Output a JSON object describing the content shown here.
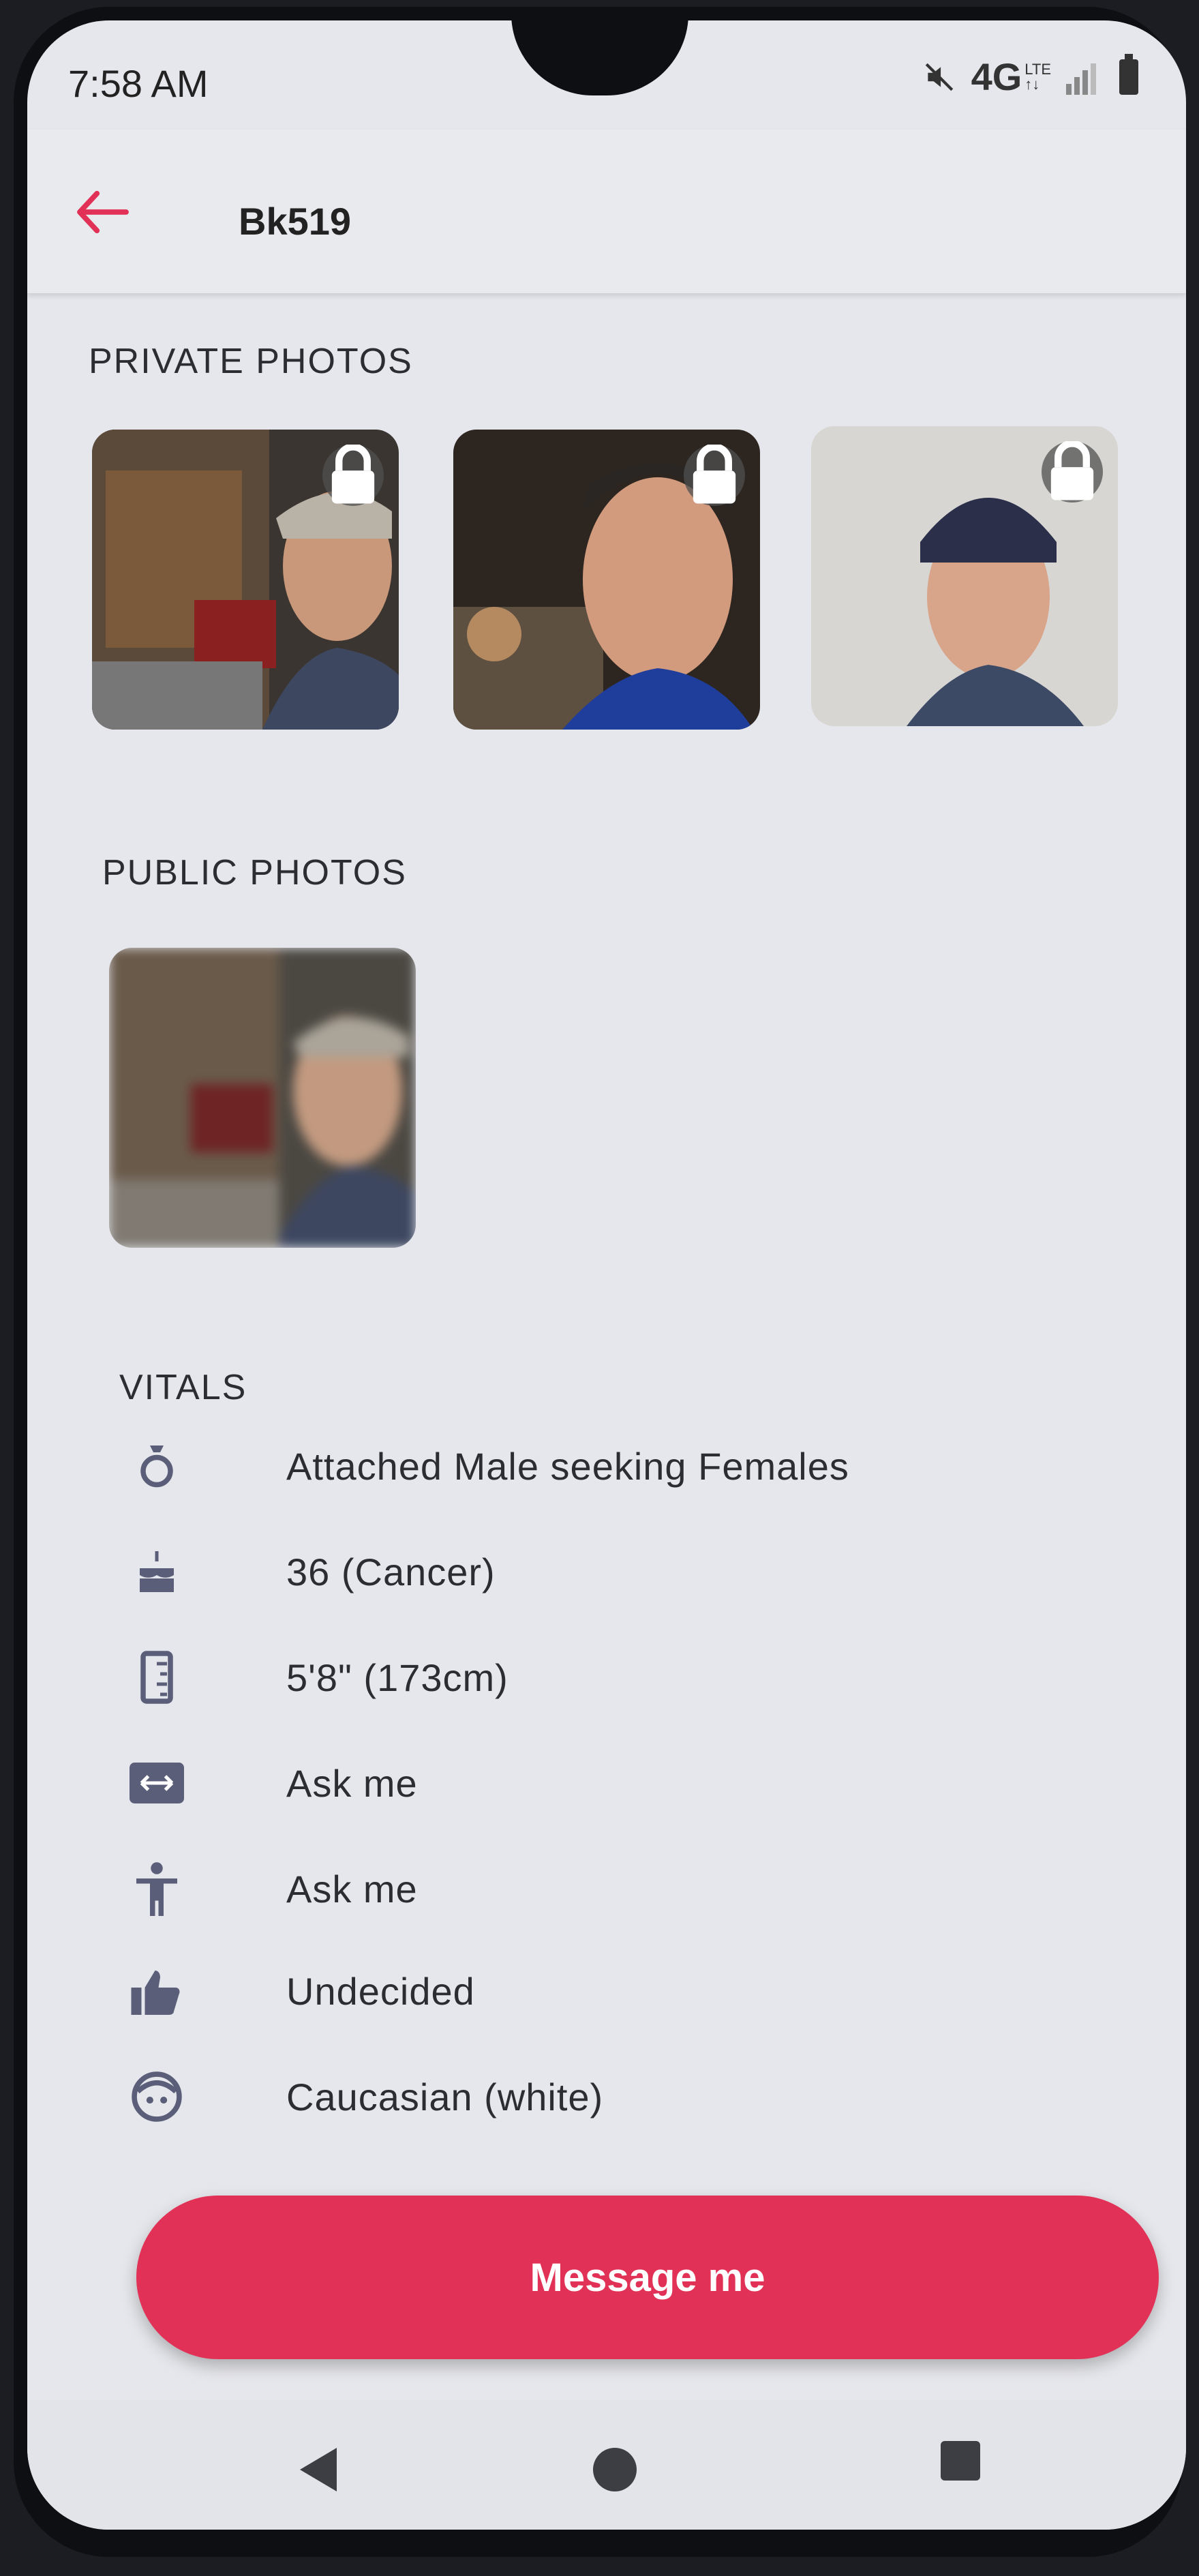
{
  "status": {
    "time": "7:58 AM",
    "network": "4G",
    "network_sub": "LTE"
  },
  "header": {
    "title": "Bk519"
  },
  "private_photos": {
    "title": "PRIVATE PHOTOS",
    "count": 3
  },
  "public_photos": {
    "title": "PUBLIC PHOTOS",
    "count": 1
  },
  "vitals": {
    "title": "VITALS",
    "items": [
      {
        "icon": "ring-icon",
        "text": "Attached Male seeking Females"
      },
      {
        "icon": "cake-icon",
        "text": "36 (Cancer)"
      },
      {
        "icon": "ruler-icon",
        "text": "5'8\" (173cm)"
      },
      {
        "icon": "width-icon",
        "text": "Ask me"
      },
      {
        "icon": "body-icon",
        "text": "Ask me"
      },
      {
        "icon": "thumbs-up-icon",
        "text": "Undecided"
      },
      {
        "icon": "face-icon",
        "text": "Caucasian (white)"
      }
    ]
  },
  "actions": {
    "message_label": "Message me"
  },
  "colors": {
    "accent": "#e23156",
    "background": "#e6e7ec",
    "text": "#2c2c33"
  }
}
